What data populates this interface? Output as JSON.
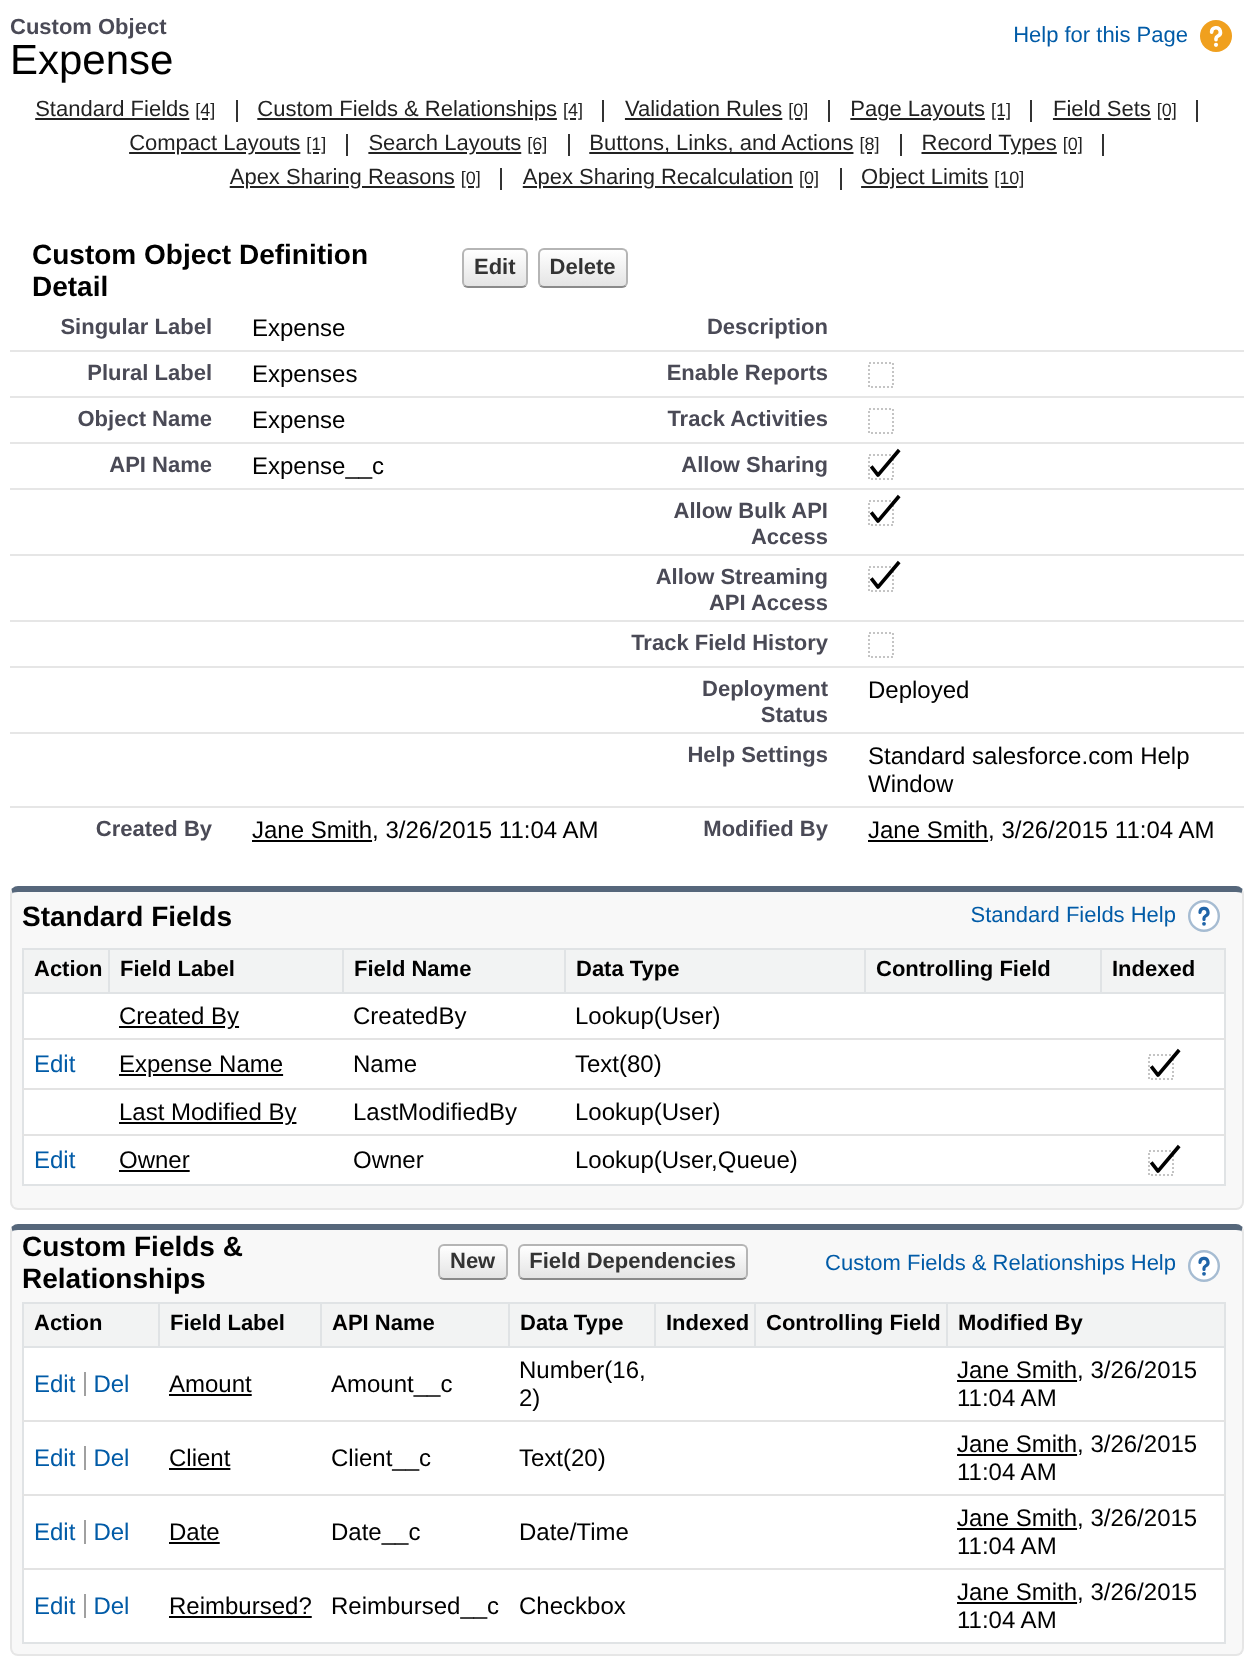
{
  "header": {
    "object_type": "Custom Object",
    "title": "Expense",
    "help_link": "Help for this Page"
  },
  "related_links": [
    {
      "label": "Standard Fields",
      "count": "[4]"
    },
    {
      "label": "Custom Fields & Relationships",
      "count": "[4]"
    },
    {
      "label": "Validation Rules",
      "count": "[0]"
    },
    {
      "label": "Page Layouts",
      "count": "[1]"
    },
    {
      "label": "Field Sets",
      "count": "[0]"
    },
    {
      "label": "Compact Layouts",
      "count": "[1]"
    },
    {
      "label": "Search Layouts",
      "count": "[6]"
    },
    {
      "label": "Buttons, Links, and Actions",
      "count": "[8]"
    },
    {
      "label": "Record Types",
      "count": "[0]"
    },
    {
      "label": "Apex Sharing Reasons",
      "count": "[0]"
    },
    {
      "label": "Apex Sharing Recalculation",
      "count": "[0]"
    },
    {
      "label": "Object Limits",
      "count": "[10]"
    }
  ],
  "detail": {
    "title": "Custom Object Definition Detail",
    "buttons": [
      "Edit",
      "Delete"
    ],
    "rows": [
      {
        "left": {
          "label": "Singular Label",
          "kind": "text",
          "value": "Expense"
        },
        "right": {
          "label": "Description",
          "kind": "text"
        }
      },
      {
        "left": {
          "label": "Plural Label",
          "kind": "text",
          "value": "Expenses"
        },
        "right": {
          "label": "Enable Reports",
          "kind": "checkbox",
          "checked": false
        }
      },
      {
        "left": {
          "label": "Object Name",
          "kind": "text",
          "value": "Expense"
        },
        "right": {
          "label": "Track Activities",
          "kind": "checkbox",
          "checked": false
        }
      },
      {
        "left": {
          "label": "API Name",
          "kind": "text",
          "value": "Expense__c"
        },
        "right": {
          "label": "Allow Sharing",
          "kind": "checkbox",
          "checked": true
        }
      },
      {
        "right": {
          "label": "Allow Bulk API Access",
          "kind": "checkbox",
          "checked": true
        }
      },
      {
        "right": {
          "label": "Allow Streaming API Access",
          "kind": "checkbox",
          "checked": true
        }
      },
      {
        "right": {
          "label": "Track Field History",
          "kind": "checkbox",
          "checked": false
        }
      },
      {
        "right": {
          "label": "Deployment Status",
          "kind": "text",
          "value": "Deployed"
        }
      },
      {
        "right": {
          "label": "Help Settings",
          "kind": "text",
          "value": "Standard salesforce.com Help Window"
        }
      },
      {
        "left": {
          "label": "Created By",
          "kind": "user",
          "user": "Jane Smith",
          "date_text": ", 3/26/2015 11:04 AM"
        },
        "right": {
          "label": "Modified By",
          "kind": "user",
          "user": "Jane Smith",
          "date_text": ", 3/26/2015 11:04 AM"
        }
      }
    ]
  },
  "standard_fields": {
    "title": "Standard Fields",
    "help_link": "Standard Fields Help",
    "columns": [
      "Action",
      "Field Label",
      "Field Name",
      "Data Type",
      "Controlling Field",
      "Indexed"
    ],
    "rows": [
      {
        "field_label": "Created By",
        "field_name": "CreatedBy",
        "data_type": "Lookup(User)",
        "indexed": false
      },
      {
        "actions": [
          "Edit"
        ],
        "field_label": "Expense Name",
        "field_name": "Name",
        "data_type": "Text(80)",
        "indexed": true
      },
      {
        "field_label": "Last Modified By",
        "field_name": "LastModifiedBy",
        "data_type": "Lookup(User)",
        "indexed": false
      },
      {
        "actions": [
          "Edit"
        ],
        "field_label": "Owner",
        "field_name": "Owner",
        "data_type": "Lookup(User,Queue)",
        "indexed": true
      }
    ]
  },
  "custom_fields": {
    "title": "Custom Fields & Relationships",
    "buttons": [
      "New",
      "Field Dependencies"
    ],
    "help_link": "Custom Fields & Relationships Help",
    "columns": [
      "Action",
      "Field Label",
      "API Name",
      "Data Type",
      "Indexed",
      "Controlling Field",
      "Modified By"
    ],
    "rows": [
      {
        "actions": [
          "Edit",
          "Del"
        ],
        "field_label": "Amount",
        "api_name": "Amount__c",
        "data_type": "Number(16, 2)",
        "modified_by": {
          "user": "Jane Smith",
          "date_text": ", 3/26/2015 11:04 AM"
        }
      },
      {
        "actions": [
          "Edit",
          "Del"
        ],
        "field_label": "Client",
        "api_name": "Client__c",
        "data_type": "Text(20)",
        "modified_by": {
          "user": "Jane Smith",
          "date_text": ", 3/26/2015 11:04 AM"
        }
      },
      {
        "actions": [
          "Edit",
          "Del"
        ],
        "field_label": "Date",
        "api_name": "Date__c",
        "data_type": "Date/Time",
        "modified_by": {
          "user": "Jane Smith",
          "date_text": ", 3/26/2015 11:04 AM"
        }
      },
      {
        "actions": [
          "Edit",
          "Del"
        ],
        "field_label": "Reimbursed?",
        "api_name": "Reimbursed__c",
        "data_type": "Checkbox",
        "modified_by": {
          "user": "Jane Smith",
          "date_text": ", 3/26/2015 11:04 AM"
        }
      }
    ]
  }
}
